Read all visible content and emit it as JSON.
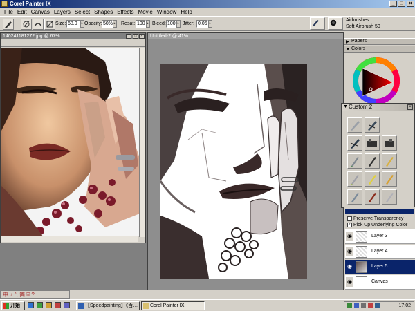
{
  "window": {
    "title": "Corel Painter IX"
  },
  "menu": [
    "File",
    "Edit",
    "Canvas",
    "Layers",
    "Select",
    "Shapes",
    "Effects",
    "Movie",
    "Window",
    "Help"
  ],
  "propbar": {
    "size_label": "Size:",
    "size_value": "68.0",
    "opacity_label": "Opacity:",
    "opacity_value": "50%",
    "resat_label": "Resat:",
    "resat_value": "100",
    "bleed_label": "Bleed:",
    "bleed_value": "100",
    "jitter_label": "Jitter:",
    "jitter_value": "0.05"
  },
  "brush": {
    "category": "Airbrushes",
    "variant": "Soft Airbrush 50"
  },
  "reference_doc": {
    "title": "140241181272.jpg @ 67%"
  },
  "canvas_doc": {
    "title": "Untitled-2 @ 41%"
  },
  "panels": {
    "papers": "Papers",
    "colors": "Colors"
  },
  "custom_palette": {
    "title": "Custom 2"
  },
  "layers_panel": {
    "preserve_transparency": {
      "label": "Preserve Transparency",
      "checked": false
    },
    "pick_up_underlying": {
      "label": "Pick Up Underlying Color",
      "checked": true
    },
    "layers": [
      {
        "name": "Layer 3",
        "selected": false
      },
      {
        "name": "Layer 4",
        "selected": false
      },
      {
        "name": "Layer 5",
        "selected": true
      },
      {
        "name": "Canvas",
        "selected": false
      }
    ]
  },
  "taskbar": {
    "start_label": "开始",
    "tasks": [
      {
        "label": "【Speedpainting】《否…",
        "active": false
      },
      {
        "label": "Corel Painter IX",
        "active": true
      }
    ],
    "clock": "17:02"
  },
  "mini_toolbox": {
    "glyphs": "中 ♪ °, 简 ⌸ ?"
  },
  "colors": {
    "title_start": "#0a246a",
    "title_end": "#a6caf0",
    "selected_layer": "#0a246a",
    "chrome": "#d4d0c8"
  }
}
